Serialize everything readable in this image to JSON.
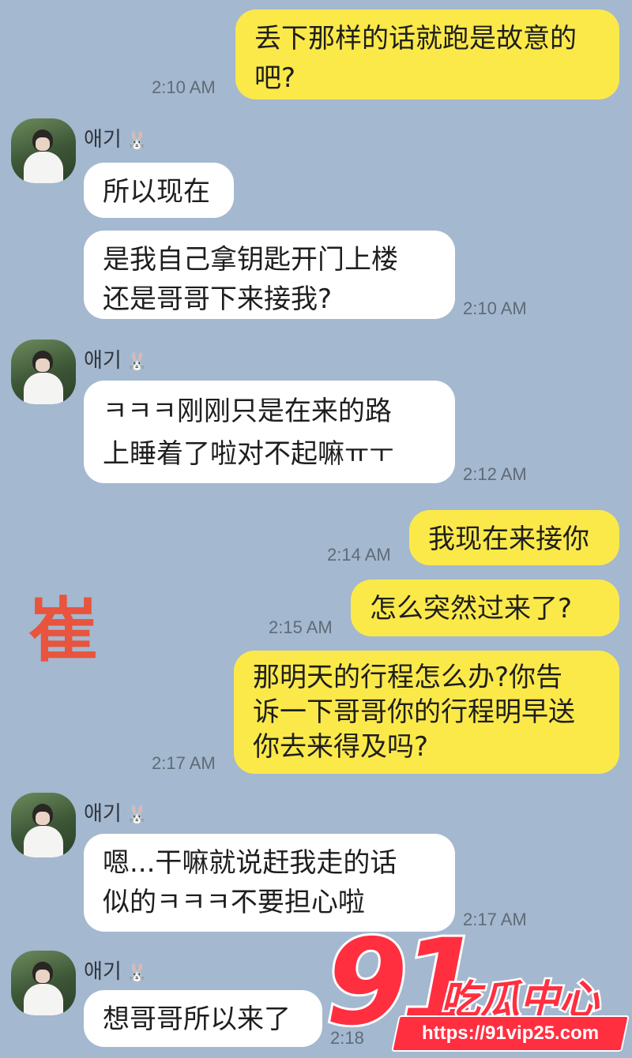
{
  "messages": [
    {
      "from": "me",
      "text": "丢下那样的话就跑是故意的\n吧?",
      "time": "2:10 AM"
    },
    {
      "from": "them",
      "sender": "애기",
      "sender_emoji": "🐰",
      "text": "所以现在"
    },
    {
      "from": "them",
      "text": "是我自己拿钥匙开门上楼\n还是哥哥下来接我?",
      "time": "2:10 AM"
    },
    {
      "from": "them",
      "sender": "애기",
      "sender_emoji": "🐰",
      "text": "ㅋㅋㅋ刚刚只是在来的路\n上睡着了啦对不起嘛ㅠㅜ",
      "time": "2:12 AM"
    },
    {
      "from": "me",
      "text": "我现在来接你",
      "time": "2:14 AM"
    },
    {
      "from": "me",
      "text": "怎么突然过来了?",
      "time": "2:15 AM"
    },
    {
      "from": "me",
      "text": "那明天的行程怎么办?你告\n诉一下哥哥你的行程明早送\n你去来得及吗?",
      "time": "2:17 AM"
    },
    {
      "from": "them",
      "sender": "애기",
      "sender_emoji": "🐰",
      "text": "嗯...干嘛就说赶我走的话\n似的ㅋㅋㅋ不要担心啦",
      "time": "2:17 AM"
    },
    {
      "from": "them",
      "sender": "애기",
      "sender_emoji": "🐰",
      "text": "想哥哥所以来了",
      "time": "2:18"
    }
  ],
  "annotation": "崔",
  "watermark": {
    "number": "91",
    "title": "吃瓜中心",
    "url": "https://91vip25.com"
  },
  "colors": {
    "background": "#a4b8cf",
    "my_bubble": "#fbe94a",
    "their_bubble": "#ffffff",
    "annotation": "#e8543d",
    "watermark": "#ff2f40"
  }
}
